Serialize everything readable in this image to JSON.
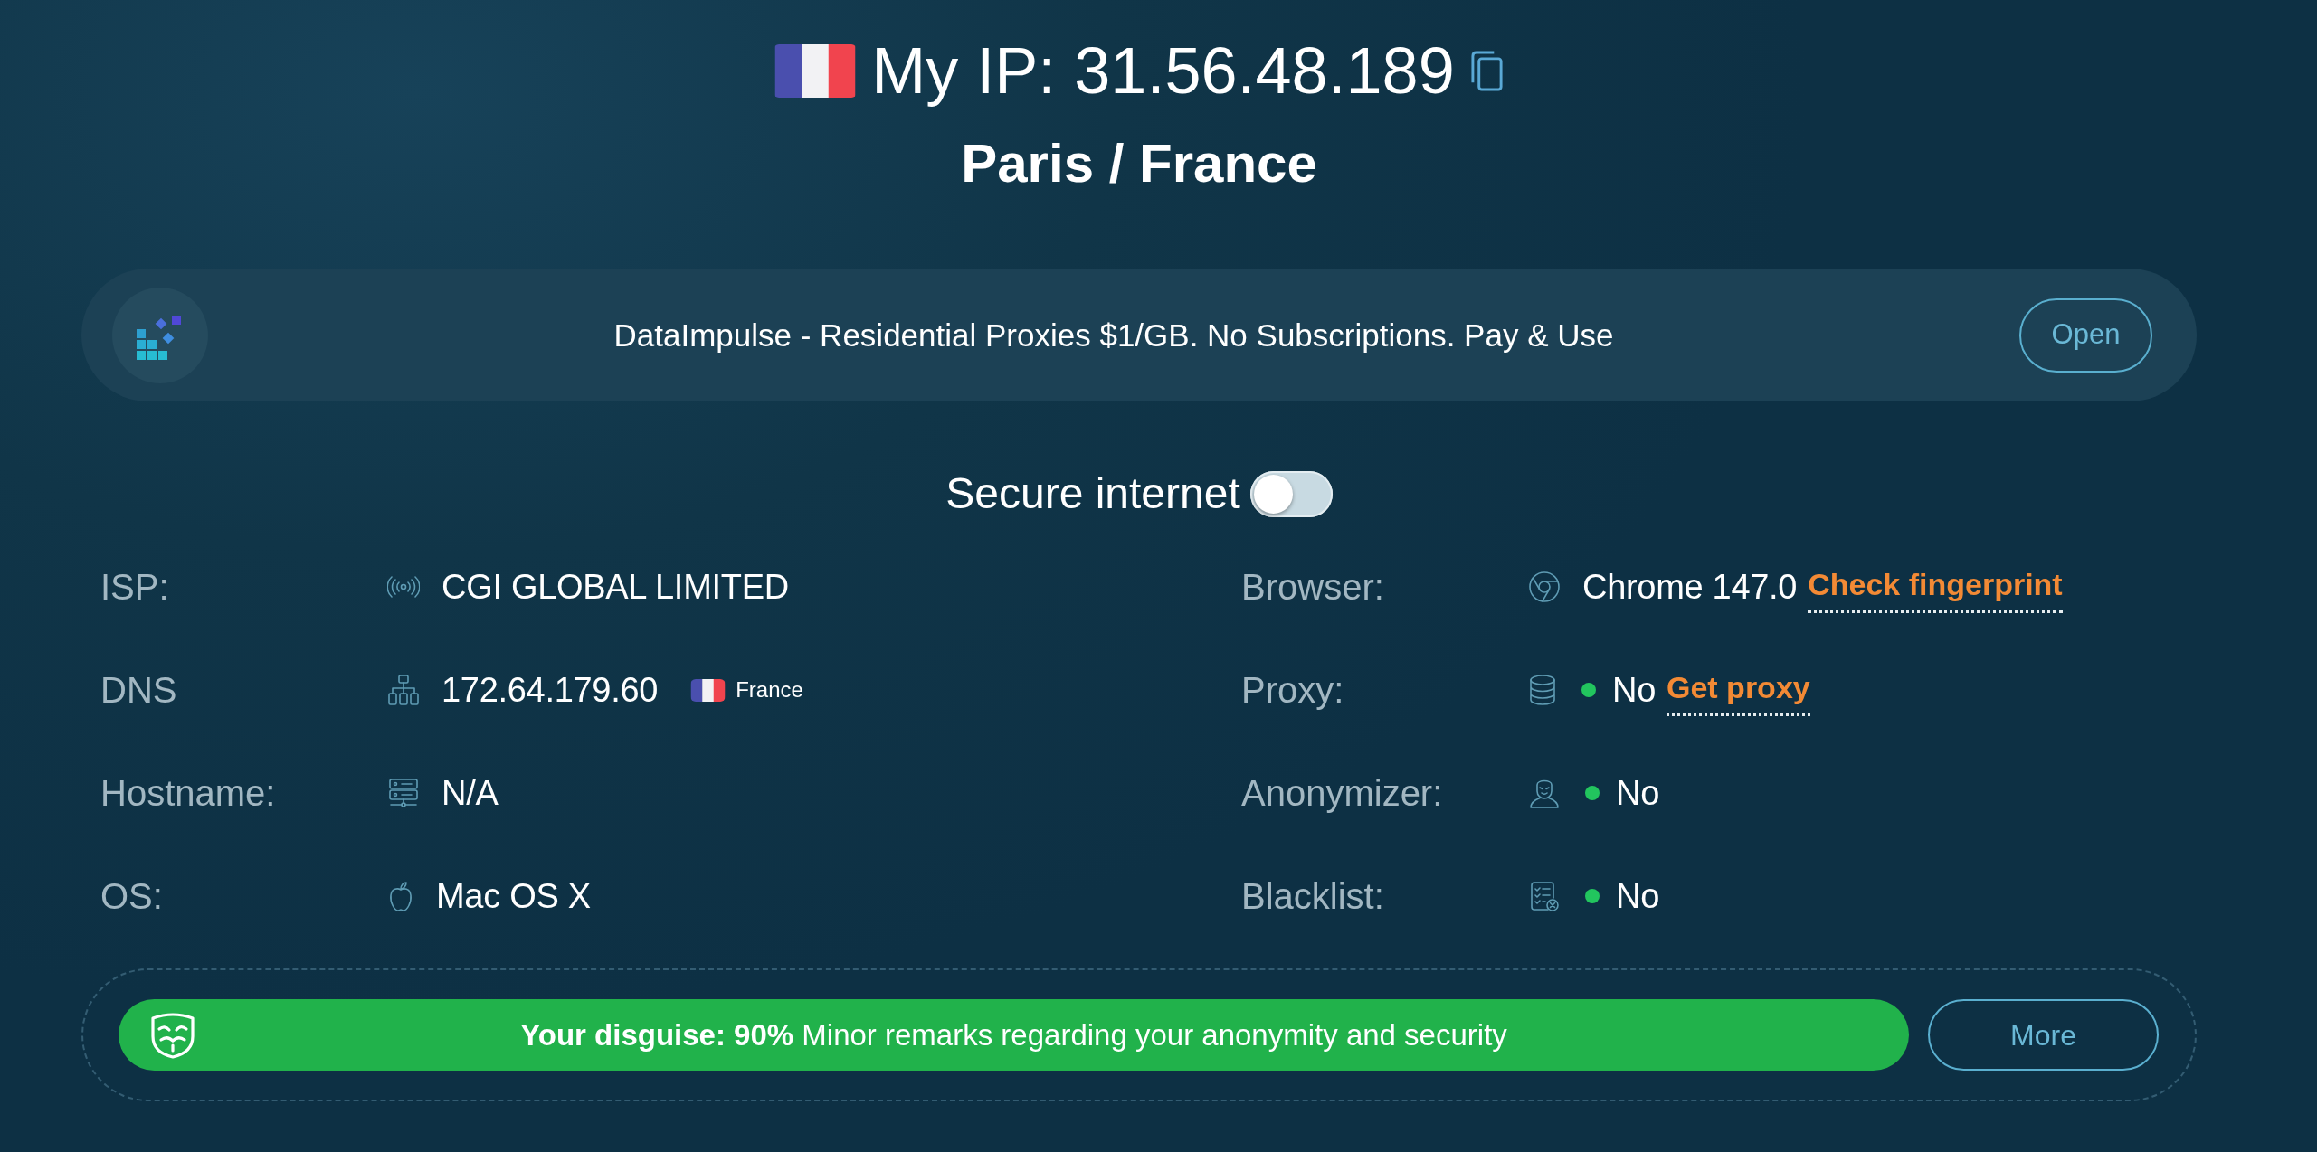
{
  "header": {
    "title": "My IP: 31.56.48.189",
    "location": "Paris / France"
  },
  "ad_banner": {
    "text": "DataImpulse - Residential Proxies $1/GB. No Subscriptions. Pay & Use",
    "button": "Open"
  },
  "secure_internet": {
    "label": "Secure internet",
    "on": false
  },
  "info_left": [
    {
      "kind": "plain",
      "label": "ISP:",
      "value": "CGI GLOBAL LIMITED"
    },
    {
      "kind": "flag",
      "label": "DNS",
      "value": "172.64.179.60",
      "country": "France"
    },
    {
      "kind": "plain",
      "label": "Hostname:",
      "value": "N/A"
    },
    {
      "kind": "plain",
      "label": "OS:",
      "value": "Mac OS X"
    }
  ],
  "info_right": [
    {
      "kind": "plain",
      "label": "Browser:",
      "value": "Chrome 147.0",
      "link": "Check fingerprint"
    },
    {
      "kind": "status",
      "label": "Proxy:",
      "value": "No",
      "color": "#22c55e",
      "link": "Get proxy"
    },
    {
      "kind": "status",
      "label": "Anonymizer:",
      "value": "No",
      "color": "#22c55e"
    },
    {
      "kind": "status",
      "label": "Blacklist:",
      "value": "No",
      "color": "#22c55e"
    }
  ],
  "disguise": {
    "text": "**Your disguise: 90%** Minor remarks regarding your anonymity and security",
    "button": "More"
  }
}
